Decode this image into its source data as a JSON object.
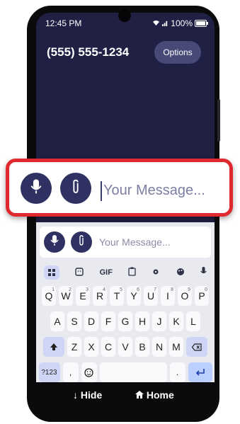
{
  "status_bar": {
    "time": "12:45 PM",
    "battery": "100%"
  },
  "header": {
    "phone_number": "(555) 555-1234",
    "options_label": "Options"
  },
  "composer": {
    "placeholder": "Your Message..."
  },
  "keyboard": {
    "toolbar": [
      "GIF"
    ],
    "row1": [
      {
        "key": "Q",
        "sup": "1"
      },
      {
        "key": "W",
        "sup": "2"
      },
      {
        "key": "E",
        "sup": "3"
      },
      {
        "key": "R",
        "sup": "4"
      },
      {
        "key": "T",
        "sup": "5"
      },
      {
        "key": "Y",
        "sup": "6"
      },
      {
        "key": "U",
        "sup": "7"
      },
      {
        "key": "I",
        "sup": "8"
      },
      {
        "key": "O",
        "sup": "9"
      },
      {
        "key": "P",
        "sup": "0"
      }
    ],
    "row2": [
      "A",
      "S",
      "D",
      "F",
      "G",
      "H",
      "J",
      "K",
      "L"
    ],
    "row3": [
      "Z",
      "X",
      "C",
      "V",
      "B",
      "N",
      "M"
    ],
    "row4": {
      "symbols_label": "?123",
      "comma": ",",
      "period": "."
    }
  },
  "nav": {
    "hide_label": "Hide",
    "home_label": "Home"
  },
  "colors": {
    "screen_bg": "#1f2044",
    "accent": "#2f3162",
    "highlight": "#e0292f"
  }
}
